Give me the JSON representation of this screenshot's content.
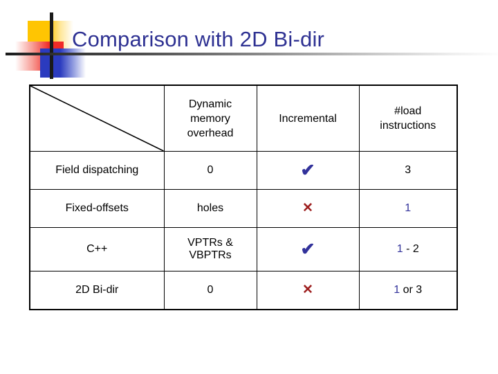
{
  "slide": {
    "title": "Comparison with 2D Bi-dir",
    "title_color": "#2E3192",
    "logo": {
      "name": "powerpoint-design-logo",
      "yellow": "#FFC502",
      "red": "#F02B28",
      "blue": "#2B3BBF",
      "bar": "#1a1a1a"
    },
    "rule_color_start": "#1a1a1a",
    "rule_color_end": "#ffffff"
  },
  "table": {
    "corner_icon": "diagonal-divider-icon",
    "headers": [
      {
        "label": "",
        "lines": []
      },
      {
        "label": "Dynamic memory overhead",
        "lines": [
          "Dynamic",
          "memory",
          "overhead"
        ]
      },
      {
        "label": "Incremental",
        "lines": [
          "Incremental"
        ]
      },
      {
        "label": "#load instructions",
        "lines": [
          "#load",
          "instructions"
        ]
      }
    ],
    "rows": [
      {
        "label": "Field dispatching",
        "dynamic_memory_overhead": {
          "text": "0",
          "color": "#32329B"
        },
        "incremental": {
          "icon": "checkmark-icon",
          "glyph": "✔",
          "color": "#32329B"
        },
        "load_instructions": {
          "parts": [
            {
              "text": "3",
              "color": "#000000"
            }
          ]
        }
      },
      {
        "label": "Fixed-offsets",
        "dynamic_memory_overhead": {
          "text": "holes",
          "color": "#CC1F1F"
        },
        "incremental": {
          "icon": "cross-icon",
          "glyph": "✕",
          "color": "#9E2020"
        },
        "load_instructions": {
          "parts": [
            {
              "text": "1",
              "color": "#32329B"
            }
          ]
        }
      },
      {
        "label": "C++",
        "dynamic_memory_overhead": {
          "text": "VPTRs & VBPTRs",
          "lines": [
            "VPTRs &",
            "VBPTRs"
          ],
          "color": "#CC1F1F"
        },
        "incremental": {
          "icon": "checkmark-icon",
          "glyph": "✔",
          "color": "#32329B"
        },
        "load_instructions": {
          "parts": [
            {
              "text": "1",
              "color": "#32329B"
            },
            {
              "text": " - 2",
              "color": "#000000"
            }
          ]
        }
      },
      {
        "label": "2D Bi-dir",
        "dynamic_memory_overhead": {
          "text": "0",
          "color": "#32329B"
        },
        "incremental": {
          "icon": "cross-icon",
          "glyph": "✕",
          "color": "#9E2020"
        },
        "load_instructions": {
          "parts": [
            {
              "text": "1",
              "color": "#32329B"
            },
            {
              "text": " or 3",
              "color": "#000000"
            }
          ]
        }
      }
    ]
  }
}
